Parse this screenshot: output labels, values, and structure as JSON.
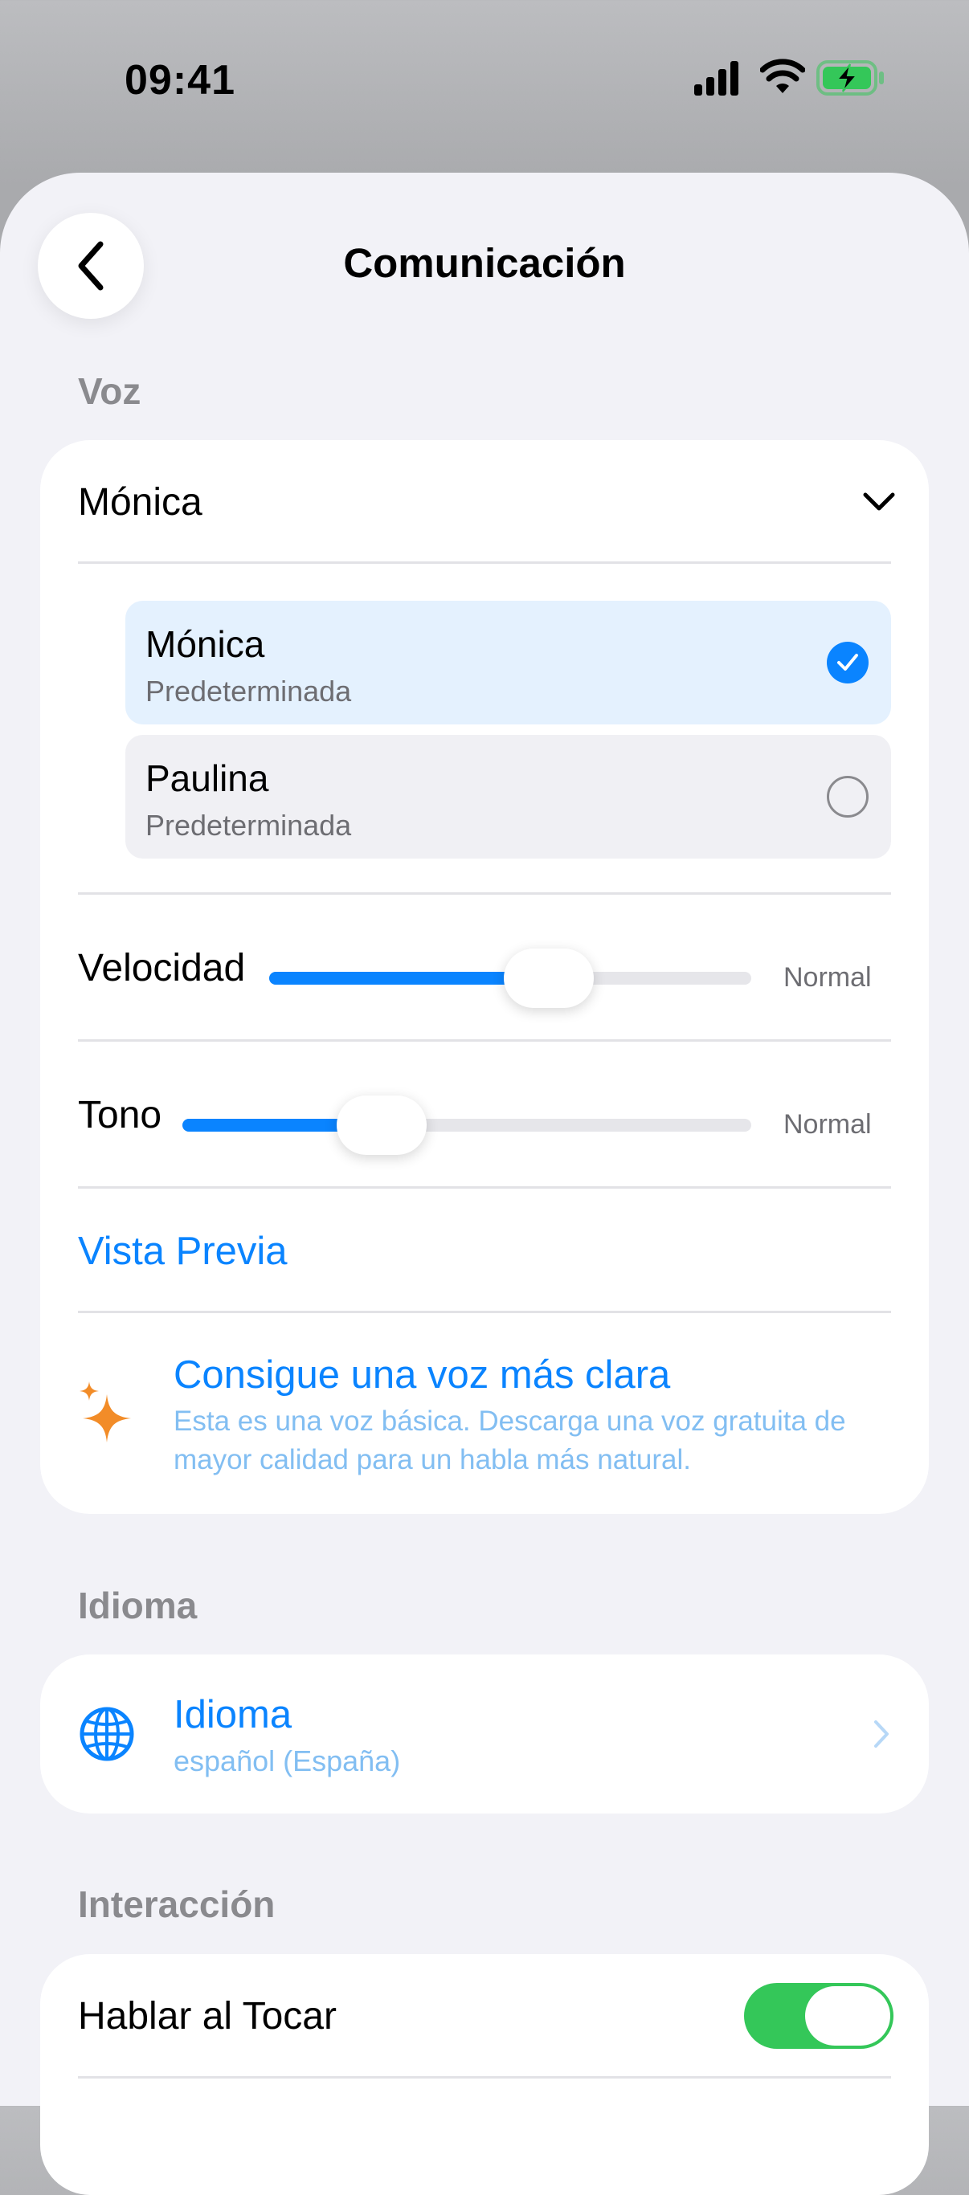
{
  "status_bar": {
    "time": "09:41",
    "icons": [
      "cellular-signal-icon",
      "wifi-icon",
      "battery-charging-icon"
    ]
  },
  "header": {
    "title": "Comunicación",
    "back_icon": "chevron-left-icon"
  },
  "voice_section": {
    "header": "Voz",
    "selected_voice": "Mónica",
    "dropdown_icon": "chevron-down-icon",
    "options": [
      {
        "name": "Mónica",
        "subtitle": "Predeterminada",
        "selected": true
      },
      {
        "name": "Paulina",
        "subtitle": "Predeterminada",
        "selected": false
      }
    ],
    "speed": {
      "label": "Velocidad",
      "value_label": "Normal",
      "level": 0.58
    },
    "pitch": {
      "label": "Tono",
      "value_label": "Normal",
      "level": 0.35
    },
    "preview_label": "Vista Previa",
    "promo": {
      "icon": "sparkles-icon",
      "title": "Consigue una voz más clara",
      "body": "Esta es una voz básica. Descarga una voz gratuita de mayor calidad para un habla más natural."
    }
  },
  "language_section": {
    "header": "Idioma",
    "title": "Idioma",
    "value": "español (España)",
    "icon": "globe-icon"
  },
  "interaction_section": {
    "header": "Interacción",
    "speak_on_tap": {
      "label": "Hablar al Tocar",
      "enabled": true
    }
  },
  "colors": {
    "accent": "#0a84ff",
    "toggle_on": "#34c759",
    "sparkle": "#f28c28",
    "background": "#f2f2f7"
  }
}
